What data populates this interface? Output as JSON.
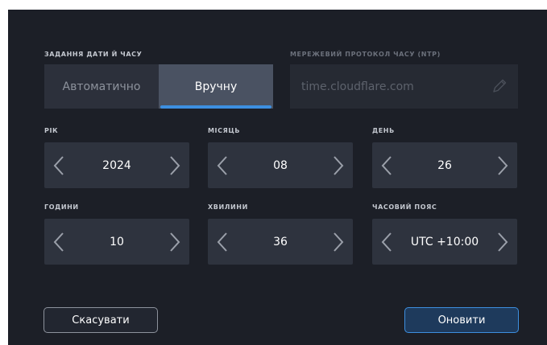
{
  "datetime_section": {
    "label": "ЗАДАННЯ ДАТИ Й ЧАСУ",
    "modes": [
      "Автоматично",
      "Вручну"
    ],
    "selected_mode": "Вручну"
  },
  "ntp": {
    "label": "МЕРЕЖЕВИЙ ПРОТОКОЛ ЧАСУ (NTP)",
    "value": "time.cloudflare.com",
    "icon": "pencil-icon"
  },
  "fields": {
    "year": {
      "label": "РІК",
      "value": "2024"
    },
    "month": {
      "label": "МІСЯЦЬ",
      "value": "08"
    },
    "day": {
      "label": "ДЕНЬ",
      "value": "26"
    },
    "hours": {
      "label": "ГОДИНИ",
      "value": "10"
    },
    "minutes": {
      "label": "ХВИЛИНИ",
      "value": "36"
    },
    "timezone": {
      "label": "ЧАСОВИЙ ПОЯС",
      "value": "UTC +10:00"
    }
  },
  "actions": {
    "cancel": "Скасувати",
    "update": "Оновити"
  },
  "colors": {
    "background": "#1c1f27",
    "accent": "#3d8fe0",
    "stepper": "#2e333e"
  }
}
